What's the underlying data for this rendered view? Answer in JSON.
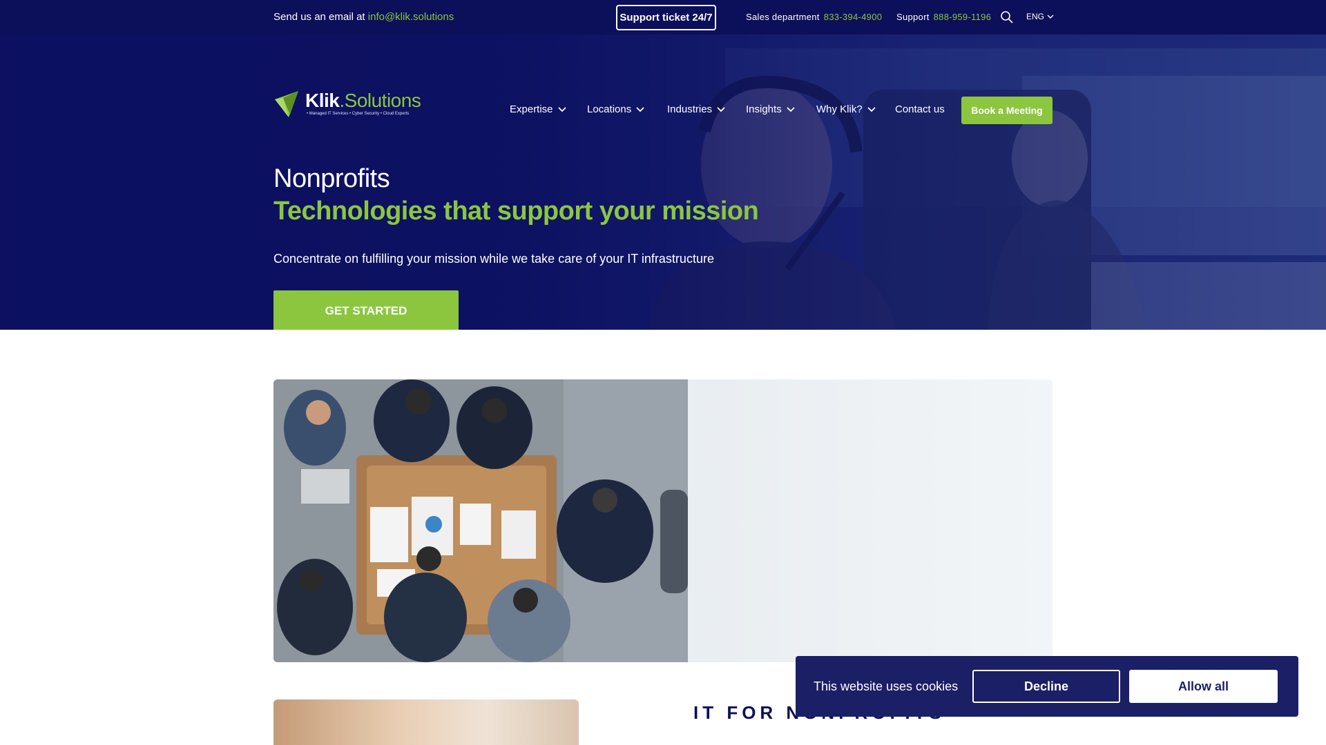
{
  "topbar": {
    "email_prefix": "Send us an email at",
    "email": "info@klik.solutions",
    "ticket_label": "Support ticket 24/7",
    "sales_label": "Sales department",
    "sales_number": "833-394-4900",
    "support_label": "Support",
    "support_number": "888-959-1196",
    "search_icon": "search-icon",
    "language": "ENG"
  },
  "logo": {
    "name": "Klik",
    "domain": ".Solutions",
    "tagline": "• Managed IT Services • Cyber Security • Cloud Experts"
  },
  "nav": {
    "items": [
      "Expertise",
      "Locations",
      "Industries",
      "Insights",
      "Why Klik?",
      "Contact us"
    ],
    "book_label": "Book a Meeting"
  },
  "hero": {
    "title": "Nonprofits",
    "subtitle": "Technologies that support your mission",
    "description": "Concentrate on fulfilling your mission while we take care of your IT infrastructure",
    "cta_label": "GET STARTED"
  },
  "section": {
    "title": "IT FOR NONPROFITS"
  },
  "cookie": {
    "message": "This website uses cookies",
    "decline_label": "Decline",
    "allow_label": "Allow all"
  },
  "colors": {
    "navy": "#0c0f5a",
    "green": "#8cc63f",
    "cookie_bg": "#1b1f66"
  }
}
